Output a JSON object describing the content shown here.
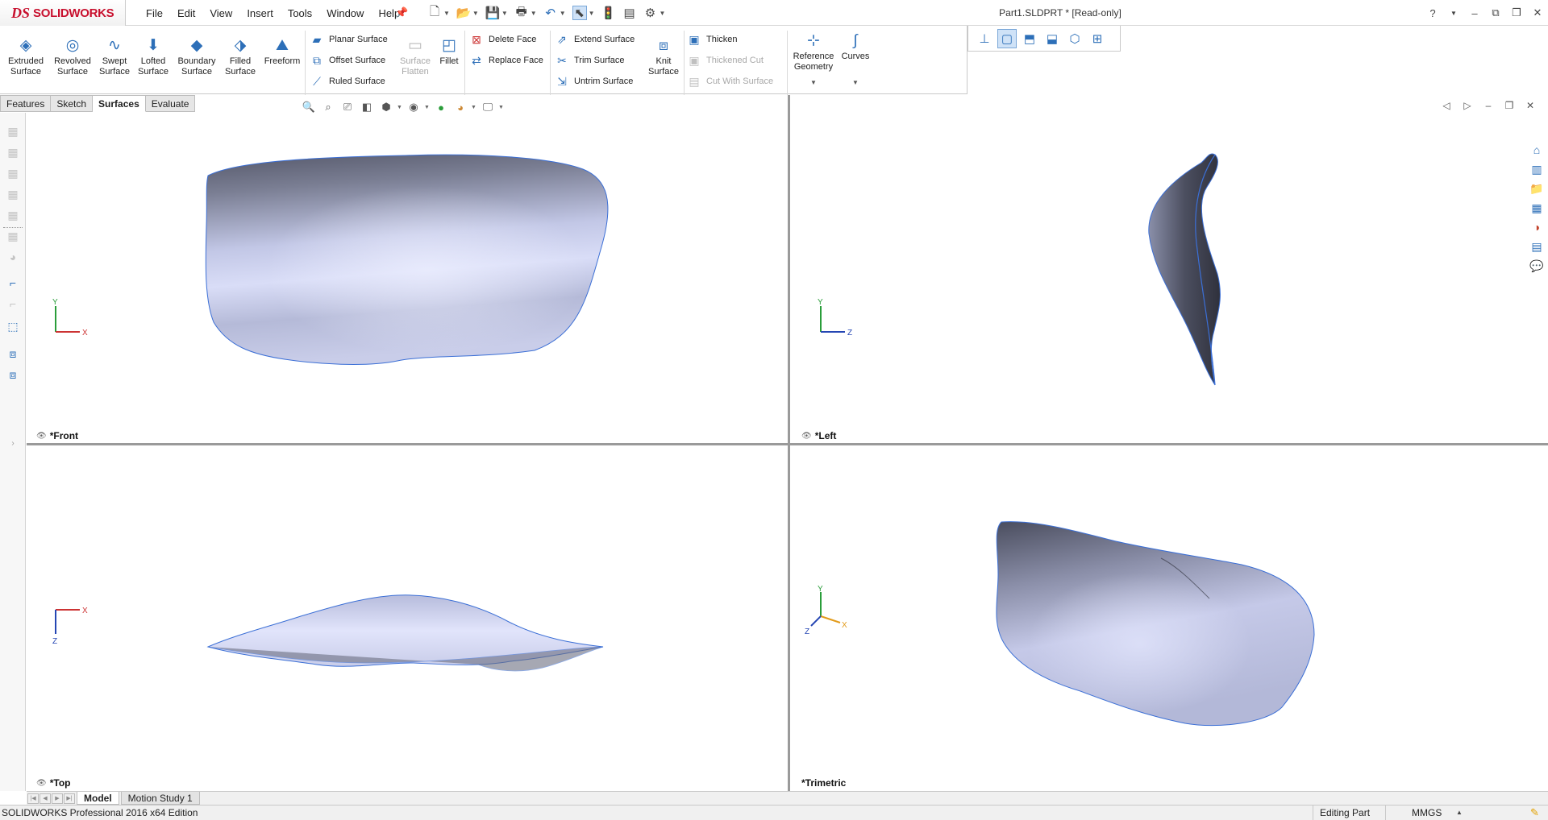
{
  "app": {
    "brand": "SOLIDWORKS",
    "logo_mark": "DS",
    "document_title": "Part1.SLDPRT * [Read-only]"
  },
  "menu": [
    "File",
    "Edit",
    "View",
    "Insert",
    "Tools",
    "Window",
    "Help"
  ],
  "quick_access": {
    "icons": [
      "new-document-icon",
      "open-icon",
      "save-icon",
      "print-icon",
      "undo-icon",
      "select-icon",
      "rebuild-icon",
      "file-properties-icon",
      "options-icon"
    ]
  },
  "window_controls": {
    "help": "?",
    "minimize": "–",
    "restore": "❐",
    "close": "✕"
  },
  "ribbon": {
    "big_buttons": [
      {
        "label": "Extruded Surface",
        "enabled": true
      },
      {
        "label": "Revolved Surface",
        "enabled": true
      },
      {
        "label": "Swept Surface",
        "enabled": true
      },
      {
        "label": "Lofted Surface",
        "enabled": true
      },
      {
        "label": "Boundary Surface",
        "enabled": true
      },
      {
        "label": "Filled Surface",
        "enabled": true
      },
      {
        "label": "Freeform",
        "enabled": true
      }
    ],
    "col1": [
      {
        "label": "Planar Surface",
        "enabled": true
      },
      {
        "label": "Offset Surface",
        "enabled": true
      },
      {
        "label": "Ruled Surface",
        "enabled": true
      }
    ],
    "surface_flatten": {
      "label": "Surface Flatten",
      "enabled": false
    },
    "fillet": {
      "label": "Fillet",
      "enabled": true
    },
    "col2": [
      {
        "label": "Delete Face",
        "enabled": true
      },
      {
        "label": "Replace Face",
        "enabled": true
      }
    ],
    "col3": [
      {
        "label": "Extend Surface",
        "enabled": true
      },
      {
        "label": "Trim Surface",
        "enabled": true
      },
      {
        "label": "Untrim Surface",
        "enabled": true
      }
    ],
    "knit_surface": {
      "label": "Knit Surface",
      "enabled": true
    },
    "col4": [
      {
        "label": "Thicken",
        "enabled": true
      },
      {
        "label": "Thickened Cut",
        "enabled": false
      },
      {
        "label": "Cut With Surface",
        "enabled": false
      }
    ],
    "reference_geometry": {
      "label": "Reference Geometry"
    },
    "curves": {
      "label": "Curves"
    }
  },
  "command_tabs": [
    {
      "label": "Features",
      "active": false
    },
    {
      "label": "Sketch",
      "active": false
    },
    {
      "label": "Surfaces",
      "active": true
    },
    {
      "label": "Evaluate",
      "active": false
    }
  ],
  "viewports": [
    {
      "label": "*Front",
      "axes": [
        "Y",
        "X"
      ]
    },
    {
      "label": "*Left",
      "axes": [
        "Y",
        "Z"
      ]
    },
    {
      "label": "*Top",
      "axes": [
        "X",
        "Z"
      ]
    },
    {
      "label": "*Trimetric",
      "axes": [
        "Y",
        "X",
        "Z"
      ]
    }
  ],
  "bottom_tabs": [
    {
      "label": "Model",
      "active": true
    },
    {
      "label": "Motion Study 1",
      "active": false
    }
  ],
  "status": {
    "edition": "SOLIDWORKS Professional 2016 x64 Edition",
    "mode": "Editing Part",
    "units": "MMGS"
  },
  "colors": {
    "accent": "#2d6fb8",
    "brand": "#c8102e",
    "surface_light": "#d8dcf5",
    "surface_dark": "#4a4d5e",
    "edge": "#3b6fd6"
  }
}
